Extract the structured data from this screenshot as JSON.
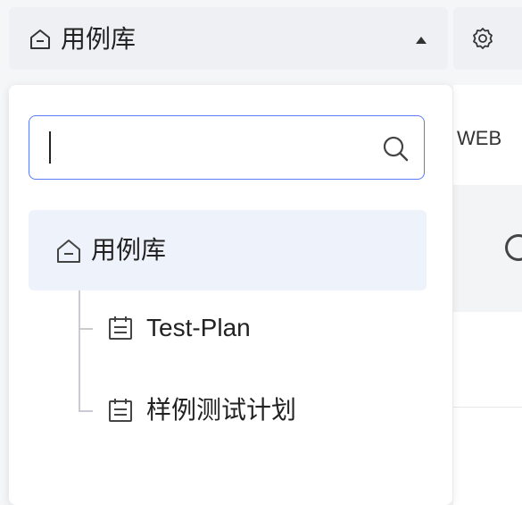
{
  "header": {
    "title": "用例库",
    "home_icon": "home-icon",
    "toggle_icon": "caret-up-icon",
    "settings_icon": "gear-icon"
  },
  "background": {
    "partial_text": "WEB"
  },
  "search": {
    "value": "",
    "placeholder": "",
    "icon": "search-icon"
  },
  "tree": {
    "root": {
      "label": "用例库",
      "icon": "home-icon",
      "selected": true
    },
    "children": [
      {
        "label": "Test-Plan",
        "icon": "calendar-icon"
      },
      {
        "label": "样例测试计划",
        "icon": "calendar-icon"
      }
    ]
  },
  "colors": {
    "accent": "#5b7bf5",
    "selected_bg": "#eef2fb",
    "topbar_bg": "#eef0f3"
  }
}
